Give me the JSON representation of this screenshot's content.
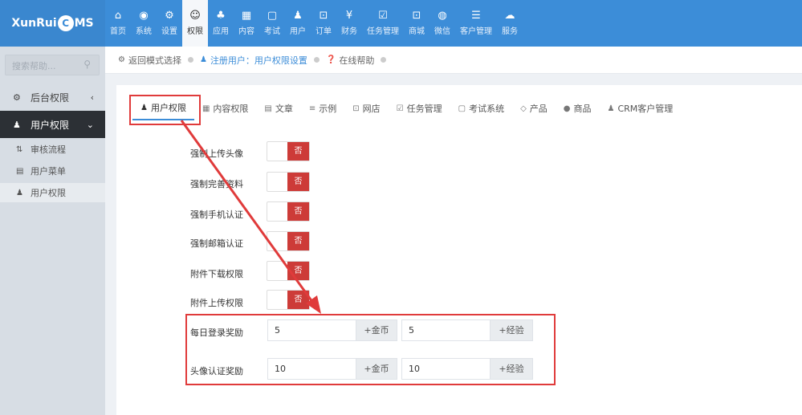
{
  "app": {
    "logo_left": "XunRui",
    "logo_c": "C",
    "logo_right": "MS"
  },
  "topnav": [
    {
      "label": "首页",
      "icon": "home-icon",
      "glyph": "⌂"
    },
    {
      "label": "系统",
      "icon": "globe-icon",
      "glyph": "◉"
    },
    {
      "label": "设置",
      "icon": "cogs-icon",
      "glyph": "⚙"
    },
    {
      "label": "权限",
      "icon": "user-circle-icon",
      "glyph": "☺",
      "active": true
    },
    {
      "label": "应用",
      "icon": "sitemap-icon",
      "glyph": "♣"
    },
    {
      "label": "内容",
      "icon": "grid-icon",
      "glyph": "▦"
    },
    {
      "label": "考试",
      "icon": "copy-icon",
      "glyph": "▢"
    },
    {
      "label": "用户",
      "icon": "user-icon",
      "glyph": "♟"
    },
    {
      "label": "订单",
      "icon": "cart-icon",
      "glyph": "⊡"
    },
    {
      "label": "财务",
      "icon": "yen-icon",
      "glyph": "¥"
    },
    {
      "label": "任务管理",
      "icon": "check-square-icon",
      "glyph": "☑"
    },
    {
      "label": "商城",
      "icon": "cart-icon",
      "glyph": "⊡"
    },
    {
      "label": "微信",
      "icon": "wechat-icon",
      "glyph": "◍"
    },
    {
      "label": "客户管理",
      "icon": "list-icon",
      "glyph": "☰"
    },
    {
      "label": "服务",
      "icon": "cloud-icon",
      "glyph": "☁"
    }
  ],
  "sidebar": {
    "search_placeholder": "搜索帮助...",
    "items": [
      {
        "label": "后台权限",
        "icon": "gear-icon",
        "glyph": "⚙",
        "chevron": "‹"
      },
      {
        "label": "用户权限",
        "icon": "user-icon",
        "glyph": "♟",
        "chevron": "⌄",
        "active": true
      }
    ],
    "subitems": [
      {
        "label": "审核流程",
        "icon": "sort-icon",
        "glyph": "⇅"
      },
      {
        "label": "用户菜单",
        "icon": "list-icon",
        "glyph": "▤"
      },
      {
        "label": "用户权限",
        "icon": "user-icon",
        "glyph": "♟",
        "active": true
      }
    ]
  },
  "breadcrumb": {
    "back": "返回模式选择",
    "current": "注册用户：用户权限设置",
    "help": "在线帮助"
  },
  "tabs": [
    {
      "label": "用户权限",
      "icon": "user-icon",
      "glyph": "♟",
      "active": true
    },
    {
      "label": "内容权限",
      "icon": "table-icon",
      "glyph": "▦"
    },
    {
      "label": "文章",
      "icon": "list-icon",
      "glyph": "▤"
    },
    {
      "label": "示例",
      "icon": "list-icon",
      "glyph": "≡"
    },
    {
      "label": "网店",
      "icon": "cart-icon",
      "glyph": "⊡"
    },
    {
      "label": "任务管理",
      "icon": "check-square-icon",
      "glyph": "☑"
    },
    {
      "label": "考试系统",
      "icon": "copy-icon",
      "glyph": "▢"
    },
    {
      "label": "产品",
      "icon": "cube-icon",
      "glyph": "◇"
    },
    {
      "label": "商品",
      "icon": "circle-icon",
      "glyph": "●"
    },
    {
      "label": "CRM客户管理",
      "icon": "users-icon",
      "glyph": "♟"
    }
  ],
  "settings": [
    {
      "label": "强制上传头像",
      "value": "否"
    },
    {
      "label": "强制完善资料",
      "value": "否"
    },
    {
      "label": "强制手机认证",
      "value": "否"
    },
    {
      "label": "强制邮箱认证",
      "value": "否"
    },
    {
      "label": "附件下载权限",
      "value": "否"
    },
    {
      "label": "附件上传权限",
      "value": "否"
    }
  ],
  "rewards": [
    {
      "label": "每日登录奖励",
      "gold": "5",
      "gold_unit": "+金币",
      "exp": "5",
      "exp_unit": "+经验"
    },
    {
      "label": "头像认证奖励",
      "gold": "10",
      "gold_unit": "+金币",
      "exp": "10",
      "exp_unit": "+经验"
    }
  ],
  "colors": {
    "accent": "#3c8dd8",
    "toggle_off": "#cd3b38",
    "highlight": "#e03b3b"
  }
}
